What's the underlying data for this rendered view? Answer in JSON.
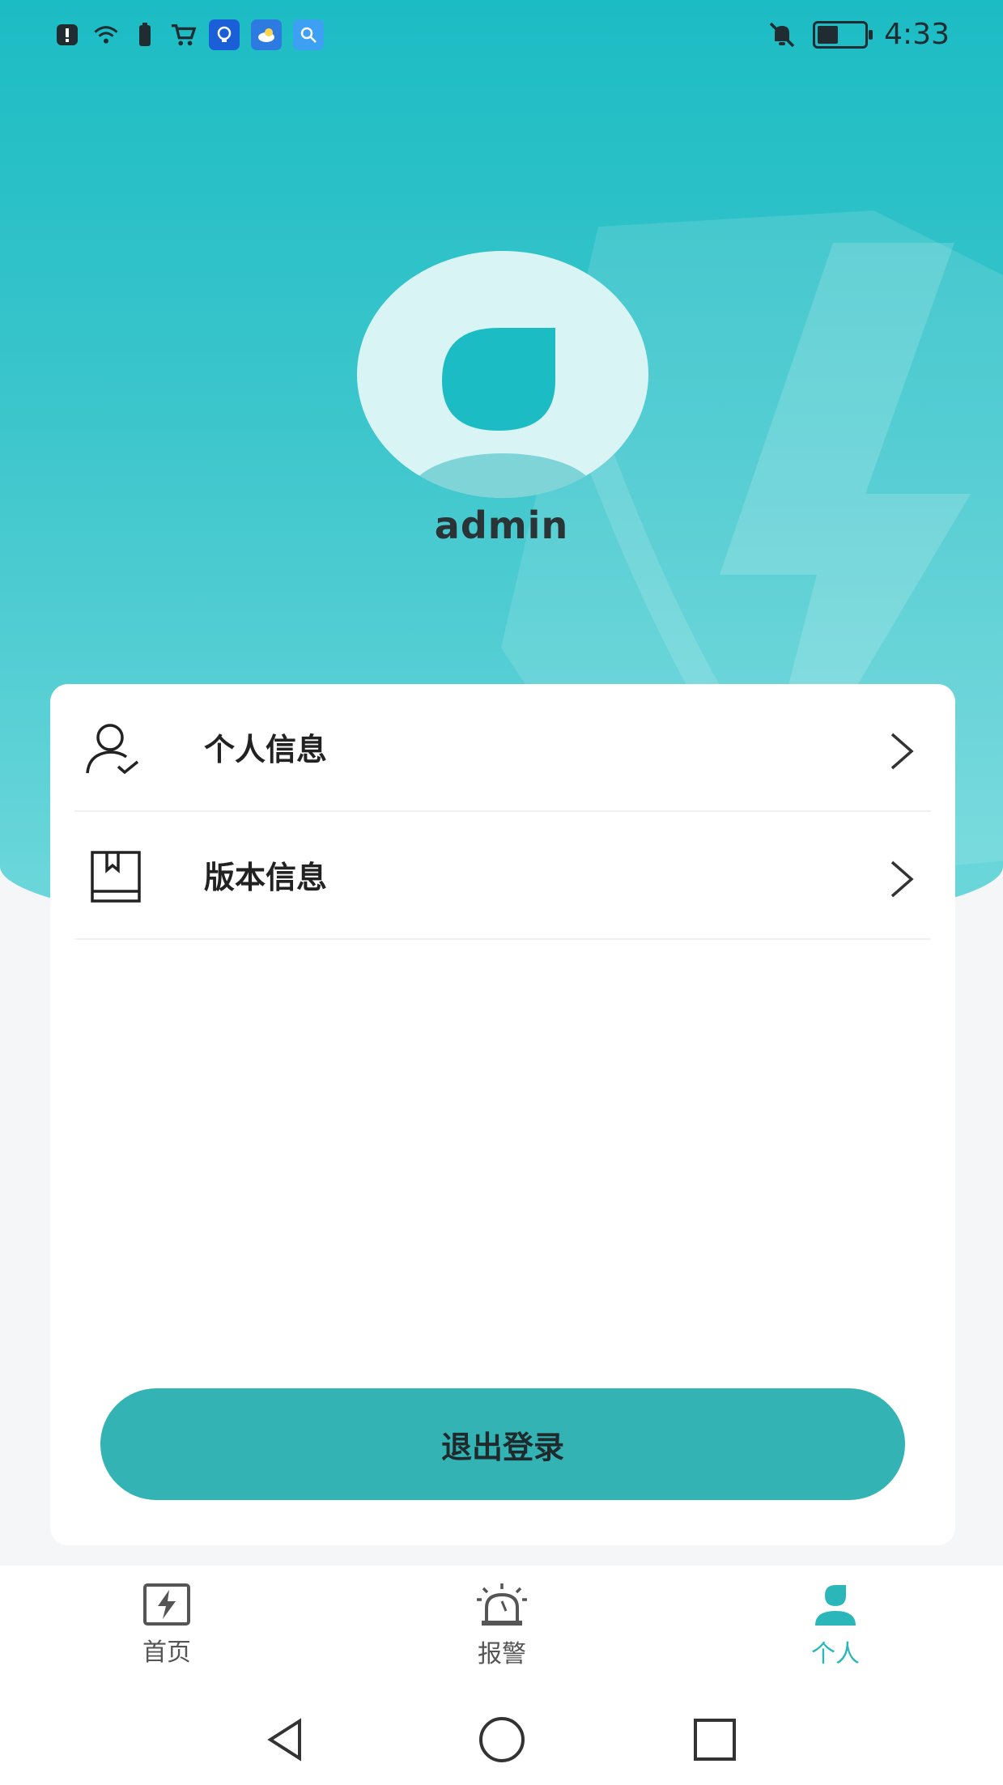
{
  "status_bar": {
    "time": "4:33",
    "left_icons": [
      "alert-icon",
      "wifi-icon",
      "battery-small-icon",
      "cart-icon",
      "app-bulb-icon",
      "app-weather-icon",
      "app-search-icon"
    ],
    "right_icons": [
      "bell-muted-icon",
      "battery-icon"
    ],
    "battery_level": 0.4
  },
  "profile": {
    "username": "admin"
  },
  "menu": {
    "items": [
      {
        "label": "个人信息",
        "icon": "user-check-icon"
      },
      {
        "label": "版本信息",
        "icon": "book-icon"
      }
    ]
  },
  "logout": {
    "label": "退出登录"
  },
  "tabbar": {
    "tabs": [
      {
        "label": "首页",
        "icon": "lightning-box-icon",
        "active": false
      },
      {
        "label": "报警",
        "icon": "alarm-siren-icon",
        "active": false
      },
      {
        "label": "个人",
        "icon": "person-icon",
        "active": true
      }
    ]
  },
  "colors": {
    "primary": "#1cbcc4",
    "button": "#34b3b4",
    "active_tab": "#2bb7b9"
  }
}
